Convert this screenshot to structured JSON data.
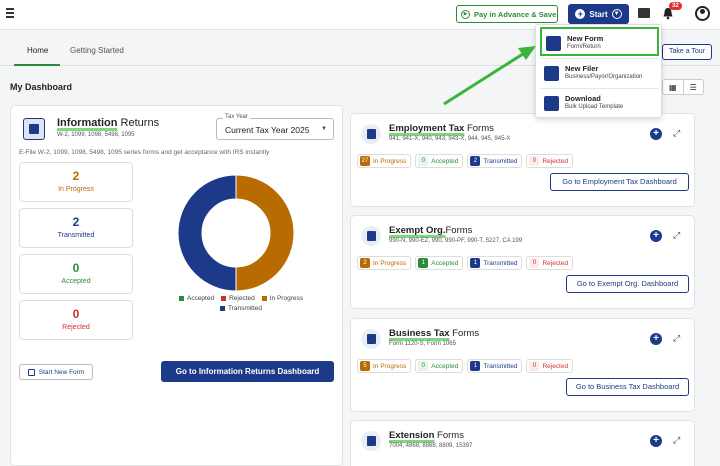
{
  "topbar": {
    "pay_label": "Pay in Advance & Save",
    "start_label": "Start",
    "notification_count": "32"
  },
  "tabs": [
    {
      "label": "Home",
      "active": true
    },
    {
      "label": "Getting Started",
      "active": false
    }
  ],
  "tour_label": "Take a Tour",
  "dashboard_title": "My Dashboard",
  "info_returns": {
    "title_bold": "Information",
    "title_rest": " Returns",
    "subtitle": "W-2, 1099, 1098, 5498, 1095",
    "tax_year_label": "Tax Year",
    "tax_year_value": "Current Tax Year 2025",
    "efile_text": "E-File W-2, 1099, 1098, 5498, 1095 series forms and get acceptance with IRS instantly",
    "stats": [
      {
        "value": "2",
        "label": "In Progress"
      },
      {
        "value": "2",
        "label": "Transmitted"
      },
      {
        "value": "0",
        "label": "Accepted"
      },
      {
        "value": "0",
        "label": "Rejected"
      }
    ],
    "legend": [
      "Accepted",
      "Rejected",
      "In Progress",
      "Transmitted"
    ],
    "start_new_label": "Start New Form",
    "dashboard_button": "Go to Information Returns Dashboard"
  },
  "chart_data": {
    "type": "pie",
    "categories": [
      "Accepted",
      "Rejected",
      "In Progress",
      "Transmitted"
    ],
    "values": [
      0,
      0,
      2,
      2
    ],
    "colors": [
      "#2e8b3d",
      "#d0302f",
      "#b86b00",
      "#1d3a8a"
    ]
  },
  "forms": [
    {
      "title_bold": "Employment Tax",
      "title_rest": " Forms",
      "subtitle": "941, 941-X, 940, 943, 943-X, 944, 945, 945-X",
      "chips": [
        {
          "n": "27",
          "label": "In Progress"
        },
        {
          "n": "0",
          "label": "Accepted"
        },
        {
          "n": "2",
          "label": "Transmitted"
        },
        {
          "n": "0",
          "label": "Rejected"
        }
      ],
      "button": "Go to Employment Tax Dashboard"
    },
    {
      "title_bold": "Exempt Org.",
      "title_rest": "Forms",
      "subtitle": "990-N, 990-EZ, 990, 990-PF, 990-T, 5227, CA 199",
      "chips": [
        {
          "n": "2",
          "label": "In Progress"
        },
        {
          "n": "1",
          "label": "Accepted"
        },
        {
          "n": "1",
          "label": "Transmitted"
        },
        {
          "n": "0",
          "label": "Rejected"
        }
      ],
      "button": "Go to Exempt Org. Dashboard"
    },
    {
      "title_bold": "Business Tax",
      "title_rest": " Forms",
      "subtitle": "Form 1120-S, Form 1065",
      "chips": [
        {
          "n": "5",
          "label": "In Progress"
        },
        {
          "n": "0",
          "label": "Accepted"
        },
        {
          "n": "1",
          "label": "Transmitted"
        },
        {
          "n": "0",
          "label": "Rejected"
        }
      ],
      "button": "Go to Business Tax Dashboard"
    },
    {
      "title_bold": "Extension",
      "title_rest": " Forms",
      "subtitle": "7004, 4868, 8868, 8809, 15397",
      "chips": [],
      "button": ""
    }
  ],
  "dropdown": [
    {
      "title": "New Form",
      "sub": "Form/Return"
    },
    {
      "title": "New Filer",
      "sub": "Business/Payor/Organization"
    },
    {
      "title": "Download",
      "sub": "Bulk Upload Template"
    }
  ]
}
